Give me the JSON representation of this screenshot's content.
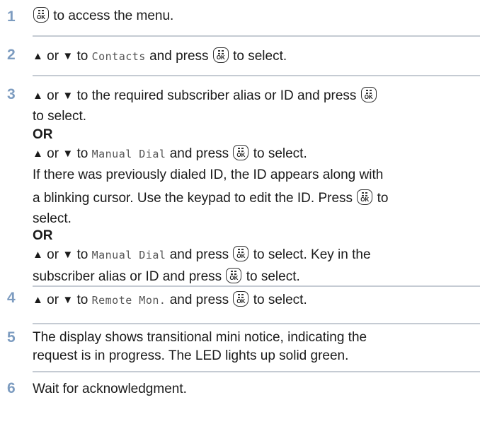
{
  "steps": [
    {
      "num": "1",
      "lines": [
        [
          {
            "k": "ok"
          },
          {
            "t": " to access the menu."
          }
        ]
      ]
    },
    {
      "num": "2",
      "lines": [
        [
          {
            "k": "up"
          },
          {
            "t": " or "
          },
          {
            "k": "down"
          },
          {
            "t": " to "
          },
          {
            "m": "Contacts"
          },
          {
            "t": " and press "
          },
          {
            "k": "ok"
          },
          {
            "t": " to select."
          }
        ]
      ]
    },
    {
      "num": "3",
      "lines": [
        [
          {
            "k": "up"
          },
          {
            "t": " or "
          },
          {
            "k": "down"
          },
          {
            "t": " to the required subscriber alias or ID and press "
          },
          {
            "k": "ok"
          }
        ],
        [
          {
            "t": "to select."
          }
        ],
        [
          {
            "b": "OR"
          }
        ],
        [
          {
            "k": "up"
          },
          {
            "t": " or "
          },
          {
            "k": "down"
          },
          {
            "t": " to "
          },
          {
            "m": "Manual Dial"
          },
          {
            "t": " and press "
          },
          {
            "k": "ok"
          },
          {
            "t": " to select."
          }
        ],
        [
          {
            "t": "If there was previously dialed ID, the ID appears along with"
          }
        ],
        [
          {
            "t": "a blinking cursor. Use the keypad to edit the ID. Press "
          },
          {
            "k": "ok"
          },
          {
            "t": " to"
          }
        ],
        [
          {
            "t": "select."
          }
        ],
        [
          {
            "b": "OR"
          }
        ],
        [
          {
            "k": "up"
          },
          {
            "t": " or "
          },
          {
            "k": "down"
          },
          {
            "t": " to "
          },
          {
            "m": "Manual Dial"
          },
          {
            "t": " and press "
          },
          {
            "k": "ok"
          },
          {
            "t": " to select. Key in the"
          }
        ],
        [
          {
            "t": "subscriber alias or ID and press "
          },
          {
            "k": "ok"
          },
          {
            "t": " to select."
          }
        ]
      ]
    },
    {
      "num": "4",
      "lines": [
        [
          {
            "k": "up"
          },
          {
            "t": " or "
          },
          {
            "k": "down"
          },
          {
            "t": " to "
          },
          {
            "m": "Remote Mon."
          },
          {
            "t": " and press "
          },
          {
            "k": "ok"
          },
          {
            "t": " to select."
          }
        ]
      ]
    },
    {
      "num": "5",
      "lines": [
        [
          {
            "t": "The display shows transitional mini notice, indicating the"
          }
        ],
        [
          {
            "t": "request is in progress. The LED lights up solid green."
          }
        ]
      ]
    },
    {
      "num": "6",
      "lines": [
        [
          {
            "t": "Wait for acknowledgment."
          }
        ]
      ]
    }
  ],
  "icons": {
    "ok_key_label": "OK",
    "up_arrow": "▲",
    "down_arrow": "▼"
  }
}
